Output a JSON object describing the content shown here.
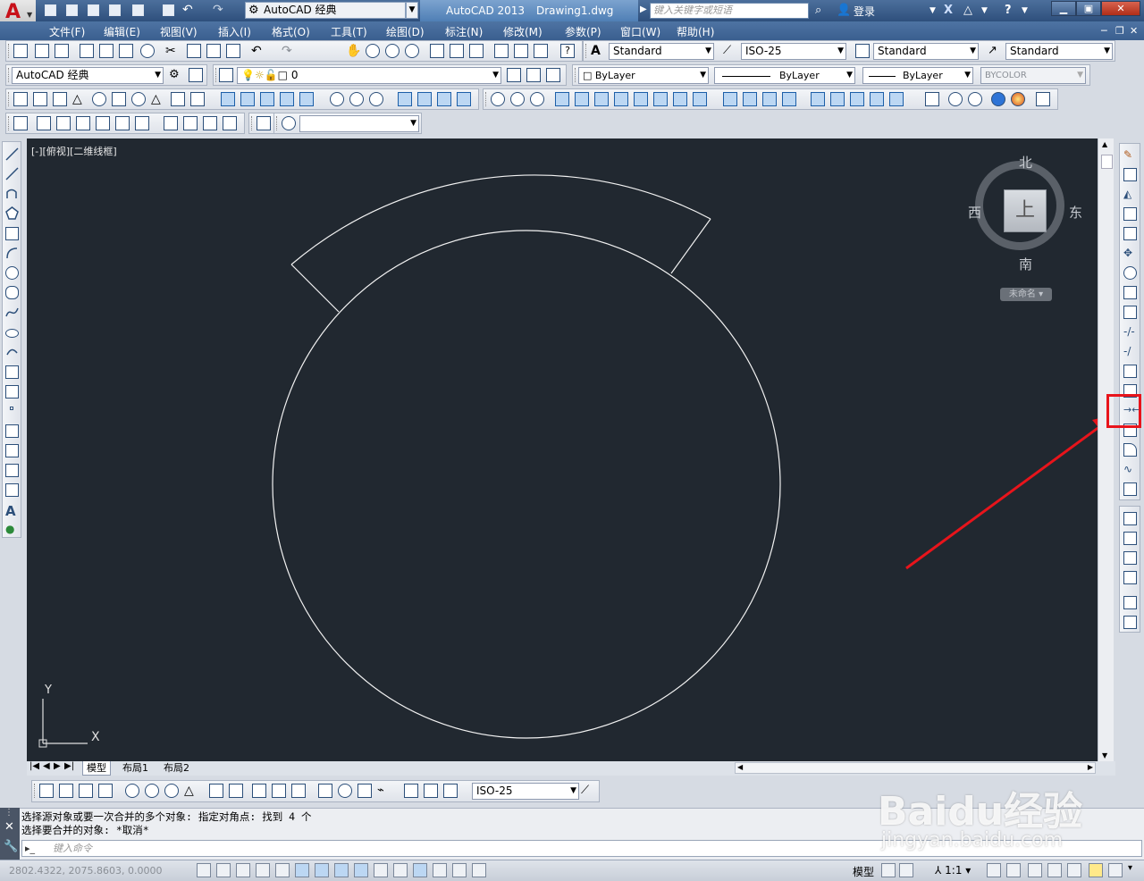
{
  "window": {
    "app_name": "AutoCAD 2013",
    "document": "Drawing1.dwg",
    "workspace": "AutoCAD 经典",
    "search_placeholder": "键入关键字或短语",
    "login": "登录"
  },
  "menu": [
    "文件(F)",
    "编辑(E)",
    "视图(V)",
    "插入(I)",
    "格式(O)",
    "工具(T)",
    "绘图(D)",
    "标注(N)",
    "修改(M)",
    "参数(P)",
    "窗口(W)",
    "帮助(H)"
  ],
  "styles_toolbar": {
    "text_style": "Standard",
    "dim_style": "ISO-25",
    "table_style": "Standard",
    "mleader_style": "Standard"
  },
  "layers_toolbar": {
    "workspace": "AutoCAD 经典",
    "current_layer": "0",
    "color": "ByLayer",
    "linetype": "ByLayer",
    "lineweight": "ByLayer",
    "plotstyle": "BYCOLOR"
  },
  "viewport": {
    "label": "[-][俯视][二维线框]",
    "viewcube": {
      "north": "北",
      "south": "南",
      "east": "东",
      "west": "西",
      "top": "上",
      "wcs": "未命名"
    },
    "ucs": {
      "x": "X",
      "y": "Y"
    }
  },
  "tabs": [
    "模型",
    "布局1",
    "布局2"
  ],
  "dim_toolbar": {
    "dim_style": "ISO-25"
  },
  "command": {
    "history": [
      "选择源对象或要一次合并的多个对象: 指定对角点: 找到 4 个",
      "选择要合并的对象: *取消*"
    ],
    "placeholder": "键入命令"
  },
  "status": {
    "coords": "2802.4322, 2075.8603, 0.0000",
    "model_label": "模型",
    "scale": "1:1"
  },
  "watermark": {
    "text": "Baidu经验",
    "url": "jingyan.baidu.com"
  },
  "annotation_color": "#e8141b"
}
